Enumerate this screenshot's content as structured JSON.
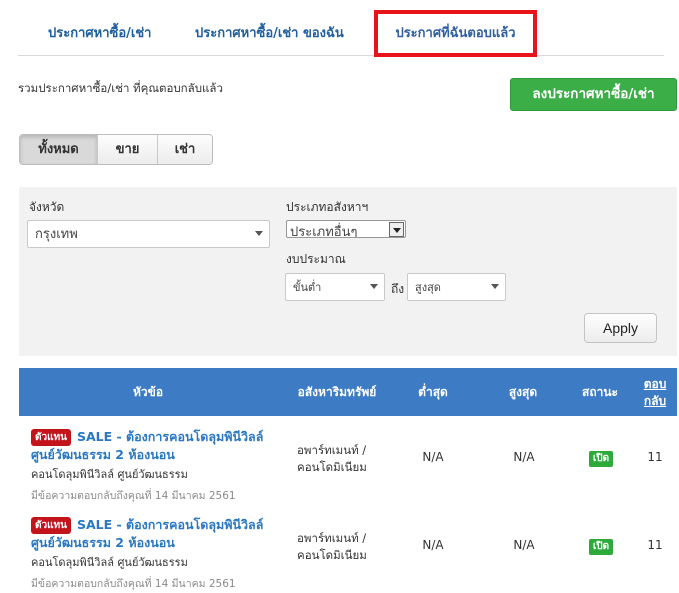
{
  "tabs": [
    {
      "label": "ประกาศหาซื้อ/เช่า"
    },
    {
      "label": "ประกาศหาซื้อ/เช่า ของฉัน"
    },
    {
      "label": "ประกาศที่ฉันตอบแล้ว"
    }
  ],
  "subtitle": "รวมประกาศหาซื้อ/เช่า ที่คุณตอบกลับแล้ว",
  "post_button": "ลงประกาศหาซื้อ/เช่า",
  "segments": [
    {
      "label": "ทั้งหมด",
      "active": true
    },
    {
      "label": "ขาย"
    },
    {
      "label": "เช่า"
    }
  ],
  "filters": {
    "province_label": "จังหวัด",
    "province_value": "กรุงเทพ",
    "type_label": "ประเภทอสังหาฯ",
    "type_value": "ประเภทอื่นๆ",
    "budget_label": "งบประมาณ",
    "min_value": "ขั้นต่ำ",
    "to_label": "ถึง",
    "max_value": "สูงสุด",
    "apply_label": "Apply"
  },
  "table": {
    "headers": [
      "หัวข้อ",
      "อสังหาริมทรัพย์",
      "ต่ำสุด",
      "สูงสุด",
      "สถานะ",
      "ตอบกลับ"
    ],
    "rows": [
      {
        "badge": "ตัวแทน",
        "title": "SALE - ต้องการคอนโดลุมพินีวิลล์ ศูนย์วัฒนธรรม 2 ห้องนอน",
        "project": "คอนโดลุมพินีวิลล์ ศูนย์วัฒนธรรม",
        "reply_note": "มีข้อความตอบกลับถึงคุณที่ 14 มีนาคม 2561",
        "property_type": "อพาร์ทเมนท์ / คอนโดมิเนียม",
        "min": "N/A",
        "max": "N/A",
        "status": "เปิด",
        "replies": "11"
      },
      {
        "badge": "ตัวแทน",
        "title": "SALE - ต้องการคอนโดลุมพินีวิลล์ ศูนย์วัฒนธรรม 2 ห้องนอน",
        "project": "คอนโดลุมพินีวิลล์ ศูนย์วัฒนธรรม",
        "reply_note": "มีข้อความตอบกลับถึงคุณที่ 14 มีนาคม 2561",
        "property_type": "อพาร์ทเมนท์ / คอนโดมิเนียม",
        "min": "N/A",
        "max": "N/A",
        "status": "เปิด",
        "replies": "11"
      }
    ]
  },
  "colors": {
    "accent_blue": "#3d7cc4",
    "link_blue": "#2a78c2",
    "green": "#3cae48",
    "badge_red": "#c3141b",
    "highlight_red": "#e8141b"
  }
}
